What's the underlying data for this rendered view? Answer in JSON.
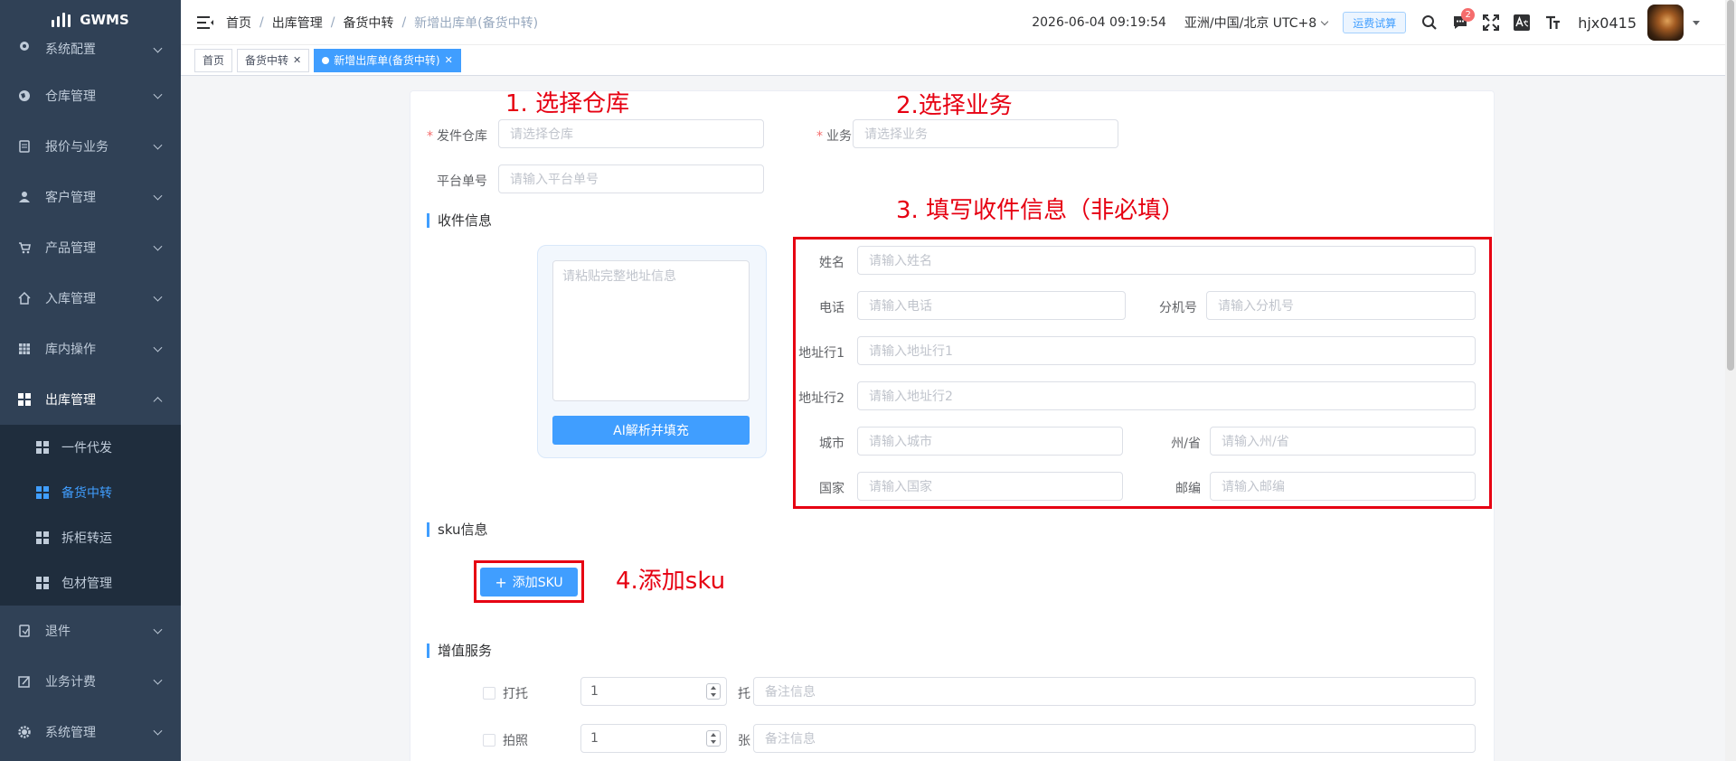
{
  "app": {
    "logo": "GWMS"
  },
  "sidebar": {
    "items": [
      {
        "label": "系统配置",
        "icon": "settings-icon"
      },
      {
        "label": "仓库管理",
        "icon": "globe-icon"
      },
      {
        "label": "报价与业务",
        "icon": "document-icon"
      },
      {
        "label": "客户管理",
        "icon": "user-icon"
      },
      {
        "label": "产品管理",
        "icon": "cart-icon"
      },
      {
        "label": "入库管理",
        "icon": "home-icon"
      },
      {
        "label": "库内操作",
        "icon": "table-icon"
      },
      {
        "label": "出库管理",
        "icon": "grid-icon"
      }
    ],
    "outbound_sub": [
      {
        "label": "一件代发"
      },
      {
        "label": "备货中转"
      },
      {
        "label": "拆柜转运"
      },
      {
        "label": "包材管理"
      }
    ],
    "items_after": [
      {
        "label": "退件",
        "icon": "return-icon"
      },
      {
        "label": "业务计费",
        "icon": "billing-icon"
      },
      {
        "label": "系统管理",
        "icon": "gear-icon"
      }
    ]
  },
  "header": {
    "breadcrumb": [
      "首页",
      "出库管理",
      "备货中转",
      "新增出库单(备货中转)"
    ],
    "datetime": "2026-06-04 09:19:54",
    "timezone": "亚洲/中国/北京 UTC+8",
    "freight_button": "运费试算",
    "message_count": "2",
    "username": "hjx0415"
  },
  "tags": [
    {
      "label": "首页"
    },
    {
      "label": "备货中转"
    },
    {
      "label": "新增出库单(备货中转)"
    }
  ],
  "annotations": {
    "a1": "1. 选择仓库",
    "a2": "2.选择业务",
    "a3": "3. 填写收件信息（非必填）",
    "a4": "4.添加sku"
  },
  "form": {
    "warehouse_label": "发件仓库",
    "warehouse_placeholder": "请选择仓库",
    "business_label": "业务",
    "business_placeholder": "请选择业务",
    "platform_label": "平台单号",
    "platform_placeholder": "请输入平台单号"
  },
  "recipient": {
    "title": "收件信息",
    "paste_placeholder": "请粘贴完整地址信息",
    "ai_button": "AI解析并填充",
    "name_label": "姓名",
    "name_ph": "请输入姓名",
    "phone_label": "电话",
    "phone_ph": "请输入电话",
    "ext_label": "分机号",
    "ext_ph": "请输入分机号",
    "addr1_label": "地址行1",
    "addr1_ph": "请输入地址行1",
    "addr2_label": "地址行2",
    "addr2_ph": "请输入地址行2",
    "city_label": "城市",
    "city_ph": "请输入城市",
    "state_label": "州/省",
    "state_ph": "请输入州/省",
    "country_label": "国家",
    "country_ph": "请输入国家",
    "zip_label": "邮编",
    "zip_ph": "请输入邮编"
  },
  "sku": {
    "title": "sku信息",
    "add_button": "添加SKU"
  },
  "value_added": {
    "title": "增值服务",
    "rows": [
      {
        "label": "打托",
        "value": "1",
        "unit": "托",
        "remark_ph": "备注信息"
      },
      {
        "label": "拍照",
        "value": "1",
        "unit": "张",
        "remark_ph": "备注信息"
      }
    ]
  },
  "colors": {
    "accent": "#409eff",
    "annotation": "#e60012",
    "sidebar_bg": "#304156"
  }
}
